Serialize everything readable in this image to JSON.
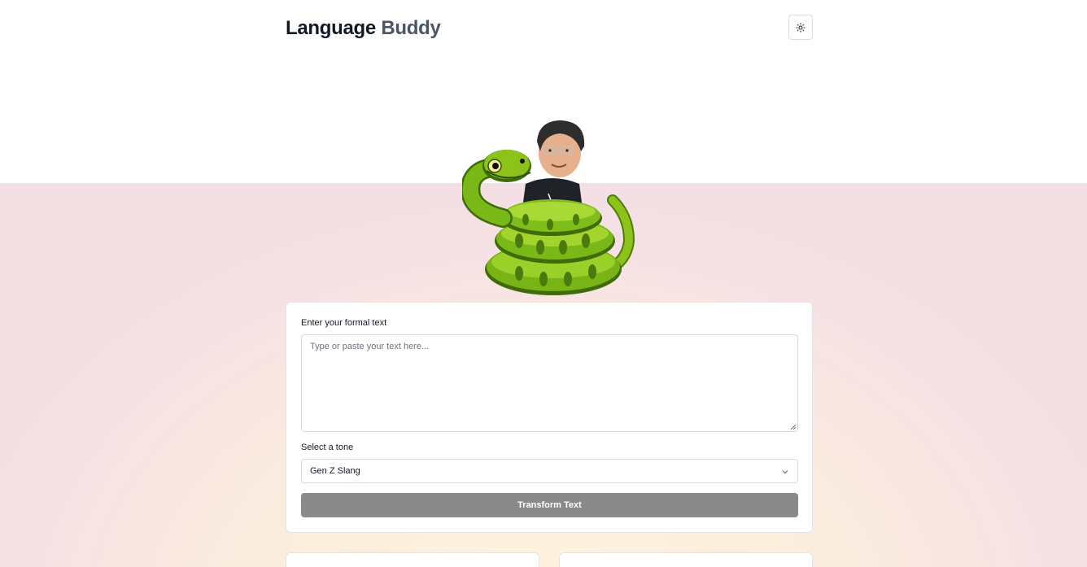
{
  "app": {
    "brand_part1": "Language",
    "brand_part2": "Buddy"
  },
  "header": {
    "theme_toggle_icon": "sun-icon"
  },
  "mascot": {
    "icon": "snake-mascot-with-avatar"
  },
  "form": {
    "text_label": "Enter your formal text",
    "text_value": "",
    "text_placeholder": "Type or paste your text here...",
    "tone_label": "Select a tone",
    "tone_selected": "Gen Z Slang",
    "submit_label": "Transform Text"
  },
  "colors": {
    "submit_bg": "#8a8a8a",
    "snake_green": "#6fa80f",
    "brand_dark": "#111827",
    "brand_muted": "#4b5563"
  }
}
